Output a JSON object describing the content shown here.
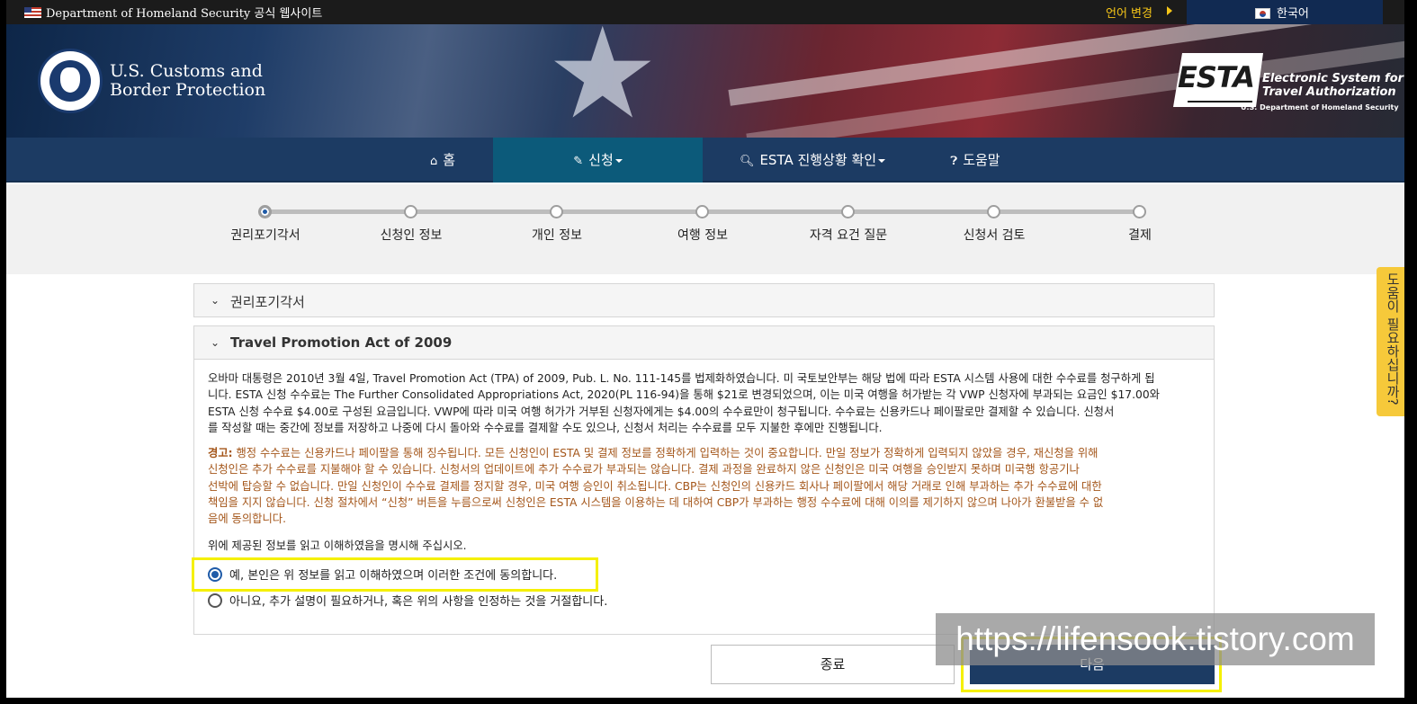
{
  "gov_bar": {
    "site_text": "Department of Homeland Security 공식 웹사이트",
    "lang_change": "언어 변경",
    "current_language": "한국어"
  },
  "banner": {
    "agency_line1": "U.S. Customs and",
    "agency_line2": "Border Protection",
    "esta_word": "ESTA",
    "esta_sub1": "Electronic System for",
    "esta_sub2": "Travel Authorization",
    "esta_dept": "U.S. Department of Homeland Security"
  },
  "nav": {
    "items": [
      {
        "label": "홈",
        "icon": "home-icon"
      },
      {
        "label": "신청",
        "icon": "pencil-icon"
      },
      {
        "label": "ESTA 진행상황 확인",
        "icon": "search-icon"
      },
      {
        "label": "도움말",
        "icon": "question-circle-icon"
      }
    ],
    "active": "신청"
  },
  "stepper": {
    "steps": [
      "권리포기각서",
      "신청인 정보",
      "개인 정보",
      "여행 정보",
      "자격 요건 질문",
      "신청서 검토",
      "결제"
    ],
    "current_step": 1
  },
  "accordion1": {
    "title": "권리포기각서"
  },
  "accordion2": {
    "title": "Travel Promotion Act of 2009",
    "para1_lines": [
      "오바마 대통령은 2010년 3월 4일, Travel Promotion Act (TPA) of 2009, Pub. L. No. 111-145를 법제화하였습니다. 미 국토보안부는 해당 법에 따라 ESTA 시스템 사용에 대한 수수료를 청구하게 됩",
      "니다. ESTA 신청 수수료는 The Further Consolidated Appropriations Act, 2020(PL 116-94)을 통해 $21로 변경되었으며, 이는 미국 여행을 허가받는 각 VWP 신청자에 부과되는 요금인 $17.00와",
      "ESTA 신청 수수료 $4.00로 구성된 요금입니다. VWP에 따라 미국 여행 허가가 거부된 신청자에게는 $4.00의 수수료만이 청구됩니다. 수수료는 신용카드나 페이팔로만 결제할 수 있습니다. 신청서",
      "를 작성할 때는 중간에 정보를 저장하고 나중에 다시 돌아와 수수료를 결제할 수도 있으나, 신청서 처리는 수수료를 모두 지불한 후에만 진행됩니다."
    ],
    "warn_label": "경고:",
    "warn_lines": [
      " 행정 수수료는 신용카드나 페이팔을 통해 징수됩니다. 모든 신청인이 ESTA 및 결제 정보를 정확하게 입력하는 것이 중요합니다. 만일 정보가 정확하게 입력되지 않았을 경우, 재신청을 위해",
      "신청인은 추가 수수료를 지불해야 할 수 있습니다. 신청서의 업데이트에 추가 수수료가 부과되는 않습니다. 결제 과정을 완료하지 않은 신청인은 미국 여행을 승인받지 못하며 미국행 항공기나",
      "선박에 탑승할 수 없습니다. 만일 신청인이 수수료 결제를 정지할 경우, 미국 여행 승인이 취소됩니다. CBP는 신청인의 신용카드 회사나 페이팔에서 해당 거래로 인해 부과하는 추가 수수료에 대한",
      "책임을 지지 않습니다. 신청 절차에서 “신청” 버튼을 누름으로써 신청인은 ESTA 시스템을 이용하는 데 대하여 CBP가 부과하는 행정 수수료에 대해 이의를 제기하지 않으며 나아가 환불받을 수 없",
      "음에 동의합니다."
    ],
    "confirm_prompt": "위에 제공된 정보를 읽고 이해하였음을 명시해 주십시오.",
    "option_yes": "예, 본인은 위 정보를 읽고 이해하였으며 이러한 조건에 동의합니다.",
    "option_no": "아니요, 추가 설명이 필요하거나, 혹은 위의 사항을 인정하는 것을 거절합니다.",
    "selected": "yes"
  },
  "buttons": {
    "exit": "종료",
    "next": "다음"
  },
  "help_tab": "도움이 필요하십니까?",
  "watermark": "https://lifensook.tistory.com",
  "colors": {
    "nav_bg": "#1c3b63",
    "nav_active": "#0c5a7a",
    "warning_text": "#a4561a",
    "highlight": "#f5f000",
    "help_tab": "#f6c93a"
  }
}
